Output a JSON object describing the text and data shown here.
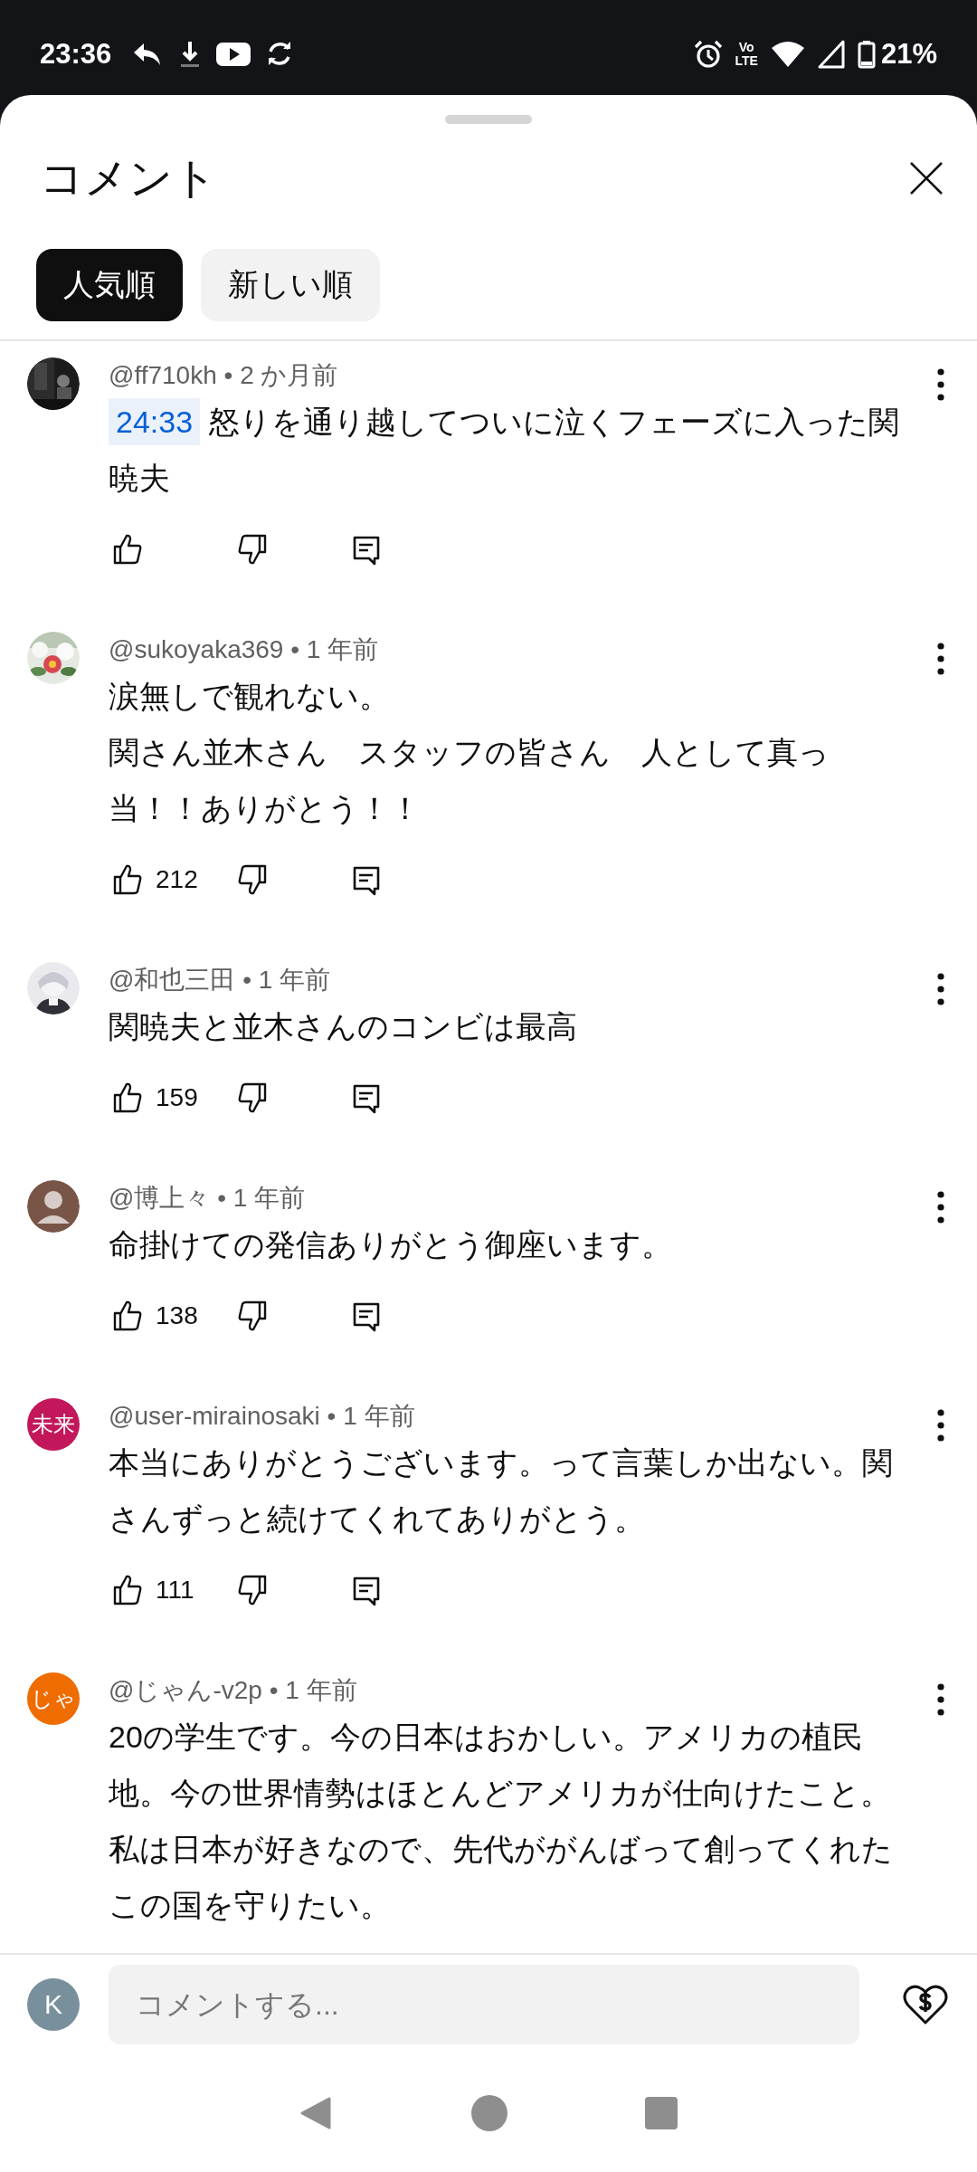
{
  "status_bar": {
    "time": "23:36",
    "network_label": [
      "Vo",
      "LTE"
    ],
    "battery": "21%"
  },
  "sheet": {
    "title": "コメント"
  },
  "sort_chips": [
    {
      "label": "人気順",
      "selected": true
    },
    {
      "label": "新しい順",
      "selected": false
    }
  ],
  "comments": [
    {
      "avatar": {
        "kind": "picture"
      },
      "author": "@ff710kh",
      "separator": "•",
      "age": "2 か月前",
      "timestamp": "24:33",
      "paragraphs": [
        "怒りを通り越してついに泣くフェーズに入った関暁夫"
      ]
    },
    {
      "avatar": {
        "kind": "picture"
      },
      "author": "@sukoyaka369",
      "separator": "•",
      "age": "1 年前",
      "paragraphs": [
        "涙無しで観れない。",
        "関さん並木さん　スタッフの皆さん　人として真っ当！！ありがとう！！"
      ],
      "likes": "212"
    },
    {
      "avatar": {
        "kind": "picture"
      },
      "author": "@和也三田",
      "separator": "•",
      "age": "1 年前",
      "paragraphs": [
        "関暁夫と並木さんのコンビは最高"
      ],
      "likes": "159"
    },
    {
      "avatar": {
        "kind": "default",
        "color": "#795548"
      },
      "author": "@博上々",
      "separator": "•",
      "age": "1 年前",
      "paragraphs": [
        "命掛けての発信ありがとう御座います。"
      ],
      "likes": "138"
    },
    {
      "avatar": {
        "kind": "initials",
        "text": "未来",
        "color": "#c2185b"
      },
      "author": "@user-mirainosaki",
      "separator": "•",
      "age": "1 年前",
      "paragraphs": [
        "本当にありがとうございます。って言葉しか出ない。関さんずっと続けてくれてありがとう。"
      ],
      "likes": "111"
    },
    {
      "avatar": {
        "kind": "initials",
        "text": "じゃ",
        "color": "#ef6c00"
      },
      "author": "@じゃん-v2p",
      "separator": "•",
      "age": "1 年前",
      "paragraphs": [
        "20の学生です。今の日本はおかしい。アメリカの植民地。今の世界情勢はほとんどアメリカが仕向けたこと。私は日本が好きなので、先代ががんばって創ってくれたこの国を守りたい。"
      ],
      "actions": false
    }
  ],
  "composer": {
    "avatar_initial": "K",
    "placeholder": "コメントする..."
  }
}
